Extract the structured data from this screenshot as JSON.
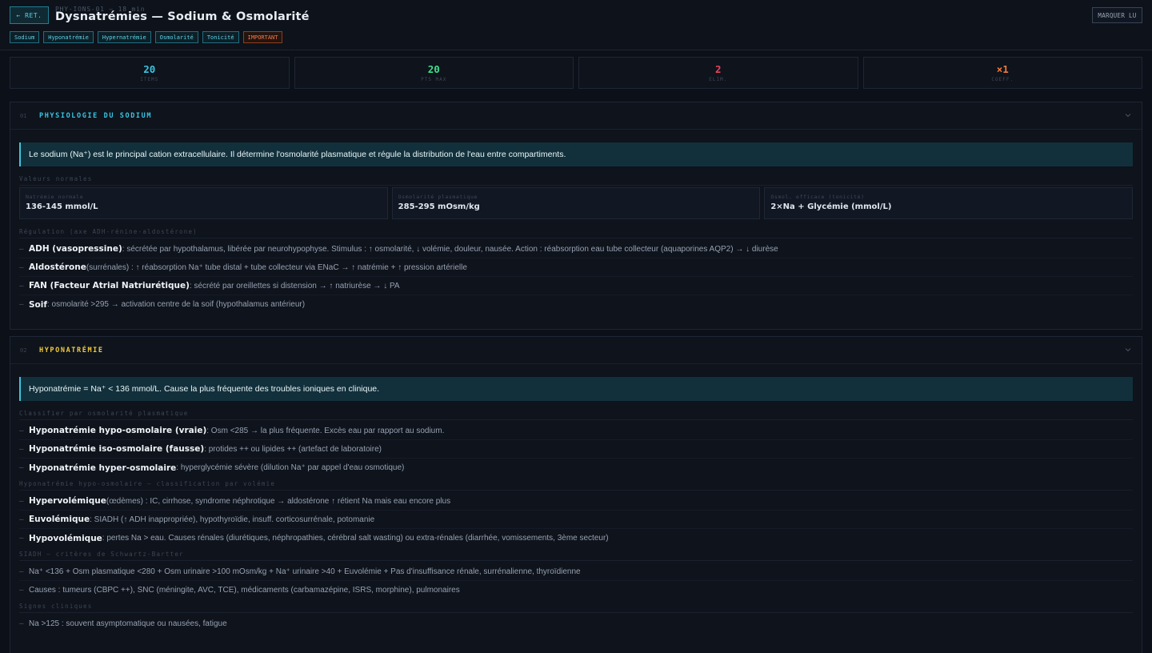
{
  "header": {
    "back_label": "← RET.",
    "meta": "PHY-IONS-01 — 18 min",
    "title": "Dysnatrémies — Sodium & Osmolarité",
    "mark_read_label": "MARQUER LU",
    "tags": [
      "Sodium",
      "Hyponatrémie",
      "Hypernatrémie",
      "Osmolarité",
      "Tonicité",
      "IMPORTANT"
    ]
  },
  "stats": [
    {
      "value": "20",
      "label": "ITEMS",
      "color": "#38c6e2"
    },
    {
      "value": "20",
      "label": "PTS MAX",
      "color": "#3ee08a"
    },
    {
      "value": "2",
      "label": "ELIM.",
      "color": "#f0415e"
    },
    {
      "value": "×1",
      "label": "COEFF.",
      "color": "#f07a3a"
    }
  ],
  "sections": {
    "s1": {
      "num": "01",
      "title": "PHYSIOLOGIE DU SODIUM",
      "title_color": "#38c6e2",
      "callout": "Le sodium (Na⁺) est le principal cation extracellulaire. Il détermine l'osmolarité plasmatique et régule la distribution de l'eau entre compartiments.",
      "normals_label": "Valeurs normales",
      "cards": [
        {
          "label": "Natrémie normale",
          "value": "136-145 mmol/L"
        },
        {
          "label": "Osmolarité plasmatique",
          "value": "285-295 mOsm/kg"
        },
        {
          "label": "Osmol. efficace (tonicité)",
          "value": "2×Na + Glycémie (mmol/L)"
        }
      ],
      "regulation_label": "Régulation (axe ADH-rénine-aldostérone)",
      "items": [
        {
          "term": "ADH (vasopressine)",
          "text": " : sécrétée par hypothalamus, libérée par neurohypophyse. Stimulus : ↑ osmolarité, ↓ volémie, douleur, nausée. Action : réabsorption eau tube collecteur (aquaporines AQP2) → ↓ diurèse"
        },
        {
          "term": "Aldostérone",
          "text": " (surrénales) : ↑ réabsorption Na⁺ tube distal + tube collecteur via ENaC → ↑ natrémie + ↑ pression artérielle"
        },
        {
          "term": "FAN (Facteur Atrial Natriurétique)",
          "text": " : sécrété par oreillettes si distension → ↑ natriurèse → ↓ PA"
        },
        {
          "term": "Soif",
          "text": " : osmolarité >295 → activation centre de la soif (hypothalamus antérieur)"
        }
      ]
    },
    "s2": {
      "num": "02",
      "title": "HYPONATRÉMIE",
      "title_color": "#f2cc3a",
      "callout": "Hyponatrémie = Na⁺ < 136 mmol/L. Cause la plus fréquente des troubles ioniques en clinique.",
      "classify_label": "Classifier par osmolarité plasmatique",
      "classify_items": [
        {
          "term": "Hyponatrémie hypo-osmolaire (vraie)",
          "text": " : Osm <285 → la plus fréquente. Excès eau par rapport au sodium."
        },
        {
          "term": "Hyponatrémie iso-osmolaire (fausse)",
          "text": " : protides ++ ou lipides ++ (artefact de laboratoire)"
        },
        {
          "term": "Hyponatrémie hyper-osmolaire",
          "text": " : hyperglycémie sévère (dilution Na⁺ par appel d'eau osmotique)"
        }
      ],
      "volemia_label": "Hyponatrémie hypo-osmolaire — classification par volémie",
      "volemia_items": [
        {
          "term": "Hypervolémique",
          "text": " (œdèmes) : IC, cirrhose, syndrome néphrotique → aldostérone ↑ rétient Na mais eau encore plus"
        },
        {
          "term": "Euvolémique",
          "text": " : SIADH (↑ ADH inappropriée), hypothyroïdie, insuff. corticosurrénale, potomanie"
        },
        {
          "term": "Hypovolémique",
          "text": " : pertes Na > eau. Causes rénales (diurétiques, néphropathies, cérébral salt wasting) ou extra-rénales (diarrhée, vomissements, 3ème secteur)"
        }
      ],
      "siadh_label": "SIADH — critères de Schwartz-Bartter",
      "siadh_items": [
        "Na⁺ <136 + Osm plasmatique <280 + Osm urinaire >100 mOsm/kg + Na⁺ urinaire >40 + Euvolémie + Pas d'insuffisance rénale, surrénalienne, thyroïdienne",
        "Causes : tumeurs (CBPC ++), SNC (méningite, AVC, TCE), médicaments (carbamazépine, ISRS, morphine), pulmonaires"
      ],
      "signs_label": "Signes cliniques",
      "signs_items": [
        "Na >125 : souvent asymptomatique ou nausées, fatigue"
      ]
    }
  }
}
